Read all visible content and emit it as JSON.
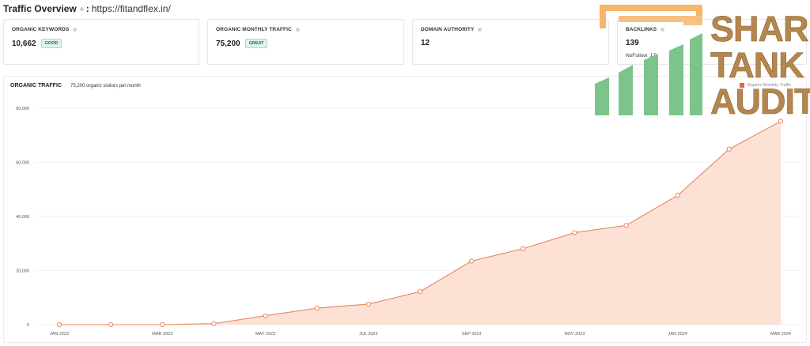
{
  "header": {
    "title": "Traffic Overview",
    "colon": ":",
    "url": "https://fitandflex.in/"
  },
  "cards": [
    {
      "label": "ORGANIC KEYWORDS",
      "value": "10,662",
      "badge": "GOOD"
    },
    {
      "label": "ORGANIC MONTHLY TRAFFIC",
      "value": "75,200",
      "badge": "GREAT"
    },
    {
      "label": "DOMAIN AUTHORITY",
      "value": "12"
    },
    {
      "label": "BACKLINKS",
      "value": "139",
      "sub": "NoFollow: 17"
    }
  ],
  "chart_panel": {
    "title": "ORGANIC TRAFFIC",
    "subtitle": "75,200 organic visitors per month",
    "legend": "Organic Monthly Traffic"
  },
  "logo": {
    "line1": "SHARK",
    "line2": "TANK",
    "line3": "AUDITS",
    "orange": "#f6b66a",
    "green": "#7cc48a",
    "gold": "#b5864d"
  },
  "colors": {
    "line": "#e8865e",
    "fill": "#fbdccd",
    "badge_bg": "#dff4ea",
    "badge_text": "#1b6b45"
  },
  "chart_data": {
    "type": "area",
    "title": "ORGANIC TRAFFIC",
    "subtitle": "75,200 organic visitors per month",
    "ylim": [
      0,
      80000
    ],
    "yticks": [
      "0",
      "20,000",
      "40,000",
      "60,000",
      "80,000"
    ],
    "ytick_values": [
      0,
      20000,
      40000,
      60000,
      80000
    ],
    "xtick_labels": [
      "JAN 2023",
      "MAR 2023",
      "MAY 2023",
      "JUL 2023",
      "SEP 2023",
      "NOV 2023",
      "JAN 2024",
      "MAR 2024"
    ],
    "xtick_index": [
      0,
      2,
      4,
      6,
      8,
      10,
      12,
      14
    ],
    "grid": true,
    "legend_position": "top-right",
    "series": [
      {
        "name": "Organic Monthly Traffic",
        "x": [
          "Jan 2023",
          "Feb 2023",
          "Mar 2023",
          "Apr 2023",
          "May 2023",
          "Jun 2023",
          "Jul 2023",
          "Aug 2023",
          "Sep 2023",
          "Oct 2023",
          "Nov 2023",
          "Dec 2023",
          "Jan 2024",
          "Feb 2024",
          "Mar 2024"
        ],
        "values": [
          0,
          0,
          0,
          400,
          3300,
          6100,
          7600,
          12200,
          23500,
          28100,
          34000,
          36700,
          47800,
          64900,
          75200
        ]
      }
    ]
  }
}
